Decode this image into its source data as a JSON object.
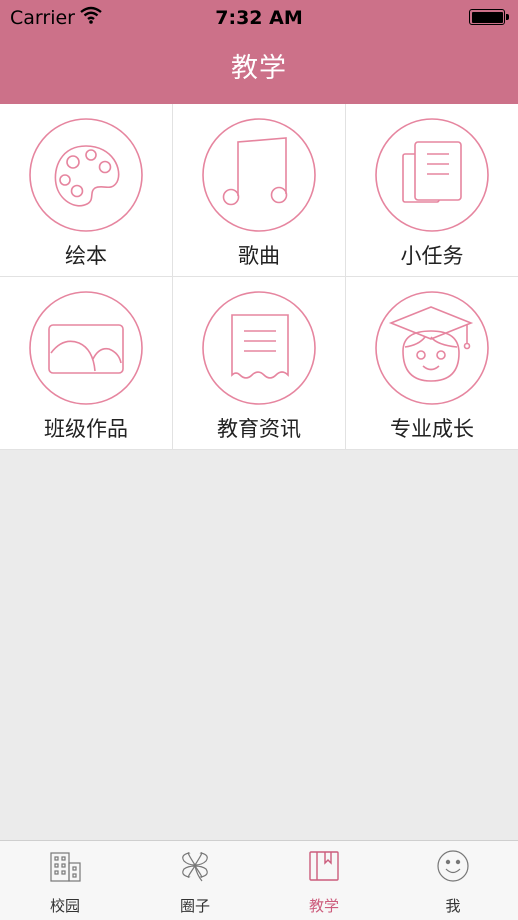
{
  "status_bar": {
    "carrier": "Carrier",
    "time": "7:32 AM"
  },
  "nav": {
    "title": "教学"
  },
  "menu": {
    "items": [
      {
        "label": "绘本",
        "icon": "palette-icon"
      },
      {
        "label": "歌曲",
        "icon": "music-note-icon"
      },
      {
        "label": "小任务",
        "icon": "documents-icon"
      },
      {
        "label": "班级作品",
        "icon": "picture-icon"
      },
      {
        "label": "教育资讯",
        "icon": "receipt-icon"
      },
      {
        "label": "专业成长",
        "icon": "graduate-icon"
      }
    ]
  },
  "tabbar": {
    "items": [
      {
        "label": "校园",
        "icon": "building-icon"
      },
      {
        "label": "圈子",
        "icon": "clover-icon"
      },
      {
        "label": "教学",
        "icon": "book-icon",
        "active": true
      },
      {
        "label": "我",
        "icon": "smiley-icon"
      }
    ]
  },
  "colors": {
    "brand": "#cc7189",
    "icon_stroke": "#e6859f",
    "active_tab": "#cc5c7c"
  }
}
